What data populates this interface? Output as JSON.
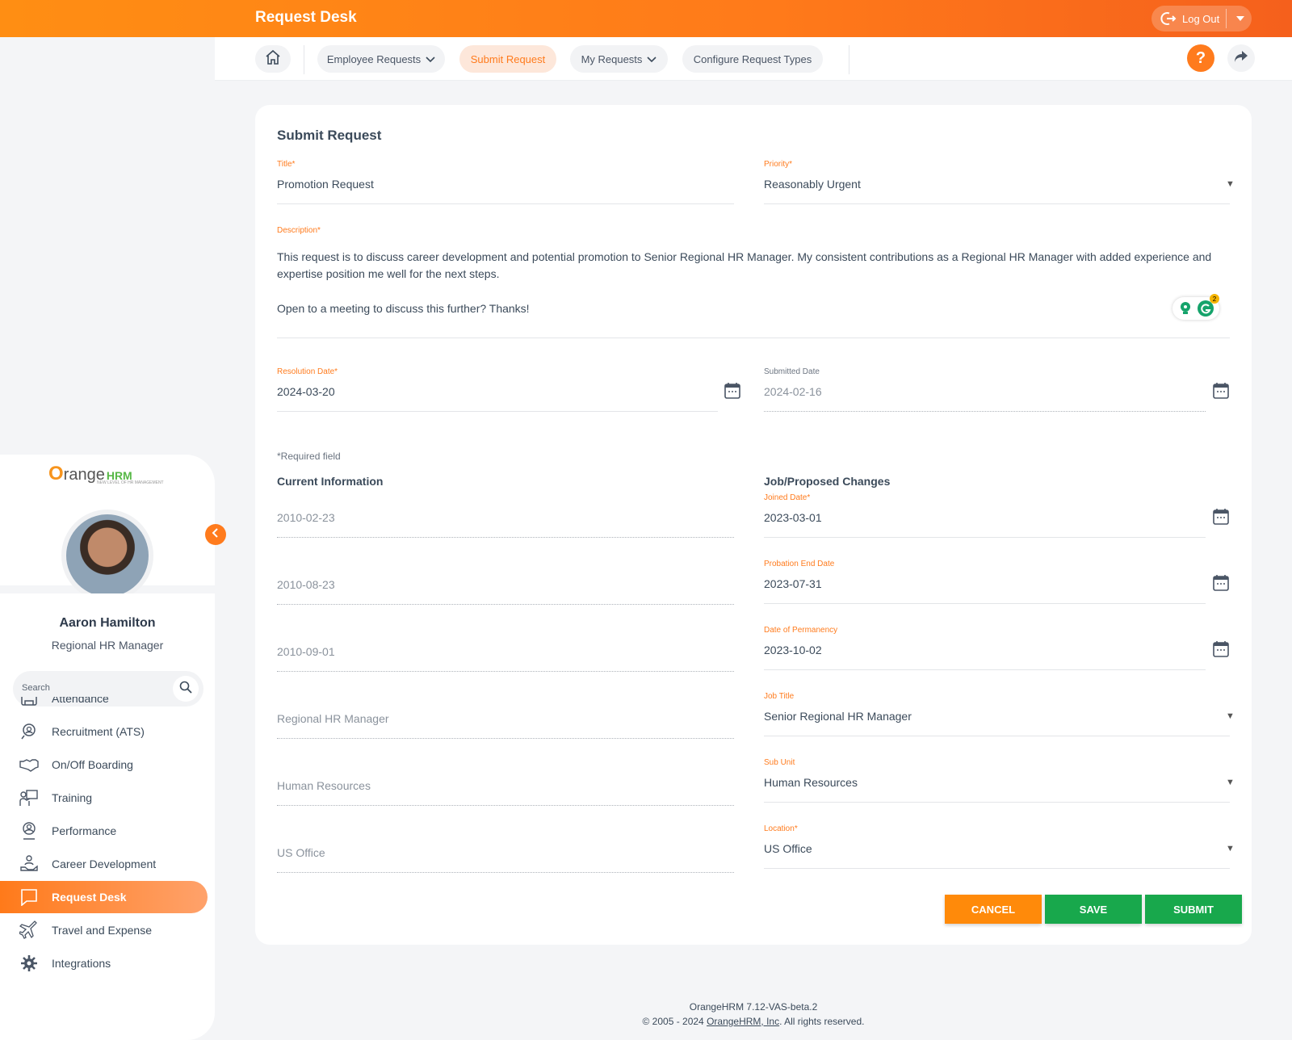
{
  "app": {
    "title": "Request Desk",
    "logout_label": "Log Out"
  },
  "nav": {
    "employee_requests": "Employee Requests",
    "submit_request": "Submit Request",
    "my_requests": "My Requests",
    "configure_request_types": "Configure Request Types",
    "help": "?"
  },
  "sidebar": {
    "logo_text": "range",
    "logo_brand": "HRM",
    "logo_tagline": "NEW LEVEL OF HR MANAGEMENT",
    "user_name": "Aaron Hamilton",
    "user_role": "Regional HR Manager",
    "search_placeholder": "Search",
    "items": [
      {
        "label": "Attendance",
        "icon": "attendance-icon"
      },
      {
        "label": "Recruitment (ATS)",
        "icon": "recruitment-icon"
      },
      {
        "label": "On/Off Boarding",
        "icon": "handshake-icon"
      },
      {
        "label": "Training",
        "icon": "training-icon"
      },
      {
        "label": "Performance",
        "icon": "performance-icon"
      },
      {
        "label": "Career Development",
        "icon": "career-icon"
      },
      {
        "label": "Request Desk",
        "icon": "request-desk-icon",
        "active": true
      },
      {
        "label": "Travel and Expense",
        "icon": "plane-icon"
      },
      {
        "label": "Integrations",
        "icon": "integrations-icon"
      }
    ]
  },
  "form": {
    "heading": "Submit Request",
    "title_label": "Title",
    "title_value": "Promotion Request",
    "priority_label": "Priority",
    "priority_value": "Reasonably Urgent",
    "description_label": "Description",
    "description_p1": "This request is to discuss career development and potential promotion to Senior Regional HR Manager. My consistent contributions as a Regional HR Manager with added experience and expertise position me well for the next steps.",
    "description_p2": "Open to a meeting to discuss this further? Thanks!",
    "grammarly_count": "2",
    "resolution_date_label": "Resolution Date",
    "resolution_date_value": "2024-03-20",
    "submitted_date_label": "Submitted Date",
    "submitted_date_value": "2024-02-16",
    "required_note": "Required field",
    "current_heading": "Current Information",
    "proposed_heading": "Job/Proposed Changes",
    "current": [
      "2010-02-23",
      "2010-08-23",
      "2010-09-01",
      "Regional HR Manager",
      "Human Resources",
      "US Office"
    ],
    "proposed": [
      {
        "label": "Joined Date",
        "value": "2023-03-01",
        "required": true
      },
      {
        "label": "Probation End Date",
        "value": "2023-07-31"
      },
      {
        "label": "Date of Permanency",
        "value": "2023-10-02"
      },
      {
        "label": "Job Title",
        "value": "Senior Regional HR Manager"
      },
      {
        "label": "Sub Unit",
        "value": "Human Resources"
      },
      {
        "label": "Location",
        "value": "US Office",
        "required": true
      }
    ],
    "cancel_label": "CANCEL",
    "save_label": "SAVE",
    "submit_label": "SUBMIT"
  },
  "footer": {
    "version": "OrangeHRM 7.12-VAS-beta.2",
    "copyright_prefix": "© 2005 - 2024 ",
    "company_link": "OrangeHRM, Inc",
    "copyright_suffix": ". All rights reserved."
  },
  "colors": {
    "accent": "#ff7b1d",
    "success": "#18a84c",
    "cancel": "#ff8a0a"
  }
}
